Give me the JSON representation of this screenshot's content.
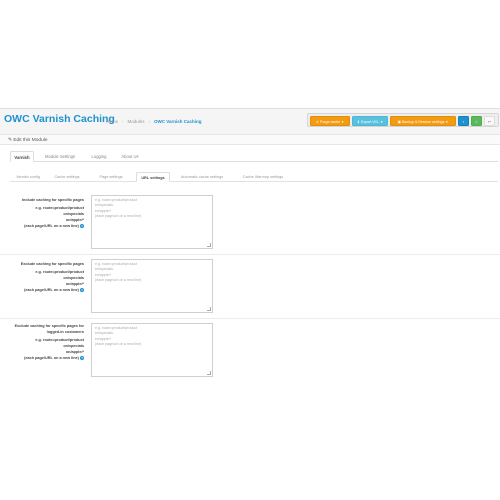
{
  "header": {
    "title": "OWC Varnish Caching",
    "breadcrumbs": [
      "Home",
      "Modules",
      "OWC Varnish Caching"
    ]
  },
  "toolbar": {
    "purge_cache": "Purge cache",
    "export_vcl": "Export VCL",
    "backup_restore": "Backup & Restore settings",
    "save_icon": "save-icon",
    "apply_icon": "check-icon",
    "back_icon": "back-icon"
  },
  "panel": {
    "heading": "Edit this Module"
  },
  "tabs_main": [
    {
      "label": "Varnish",
      "active": true
    },
    {
      "label": "Module Settings",
      "active": false
    },
    {
      "label": "Logging",
      "active": false
    },
    {
      "label": "About Us",
      "active": false
    }
  ],
  "tabs_sub": [
    {
      "label": "Varnish config",
      "active": false
    },
    {
      "label": "Cache settings",
      "active": false
    },
    {
      "label": "Page settings",
      "active": false
    },
    {
      "label": "URL settings",
      "active": true
    },
    {
      "label": "Automatic cache settings",
      "active": false
    },
    {
      "label": "Cache Warmup settings",
      "active": false
    }
  ],
  "fields": [
    {
      "label": "Include caching for specific pages",
      "hint": "e.g. route=product/product\non/specials\non/apple/*\n(each page/URL on a new line)",
      "placeholder": "e.g. route=product/product\nen/specials\nen/apple/*\n(each page/url on a new line)"
    },
    {
      "label": "Exclude caching for specific pages",
      "hint": "e.g. route=product/product\non/specials\non/apple/*\n(each page/URL on a new line)",
      "placeholder": "e.g. route=product/product\nen/specials\nen/apple/*\n(each page/url on a new line)"
    },
    {
      "label": "Exclude caching for specific pages for\nlogged-in customers",
      "hint": "e.g. route=product/product\non/specials\non/apple/*\n(each page/URL on a new line)",
      "placeholder": "e.g. route=product/product\nen/specials\nen/apple/*\n(each page/url on a new line)"
    }
  ],
  "colors": {
    "accent": "#1e91cf",
    "orange": "#f39c12",
    "teal": "#5bc0de",
    "green": "#5cb85c"
  }
}
